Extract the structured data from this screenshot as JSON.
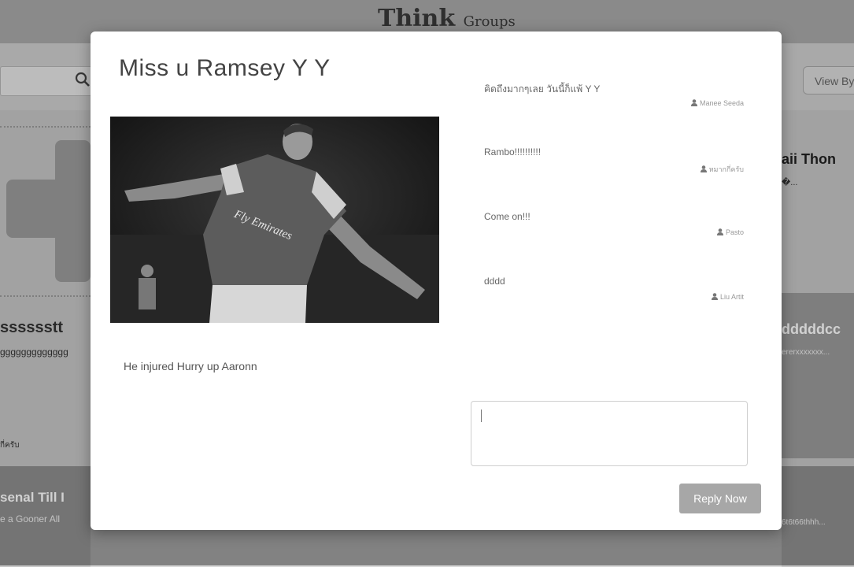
{
  "background": {
    "logo_main": "Think",
    "logo_sub": "Groups",
    "view_by_label": "View By",
    "left_cards": [
      {
        "title": "sssssstt",
        "text": "ggggggggggggg"
      },
      {
        "title": "",
        "text": "กี่ครับ"
      },
      {
        "title": "senal Till I",
        "text": "e a Gooner All"
      }
    ],
    "right_cards": [
      {
        "title": "aii Thon",
        "text": "�..."
      },
      {
        "title": "dddddcc",
        "text": "ererxxxxxxx..."
      },
      {
        "title": "",
        "text": "6t6t66thhh..."
      }
    ]
  },
  "modal": {
    "title": "Miss u Ramsey Y Y",
    "body": "He injured   Hurry up Aaronn",
    "comments": [
      {
        "text": "คิดถึงมากๆเลย วันนี้ก็แพ้ Y Y",
        "author": "Manee Seeda"
      },
      {
        "text": "Rambo!!!!!!!!!!",
        "author": "หมากกี่ครับ"
      },
      {
        "text": "Come on!!!",
        "author": "Pasto"
      },
      {
        "text": "dddd",
        "author": "Liu Artit"
      }
    ],
    "reply_placeholder": "",
    "reply_button_label": "Reply Now",
    "image_jersey_text": "Fly Emirates"
  }
}
